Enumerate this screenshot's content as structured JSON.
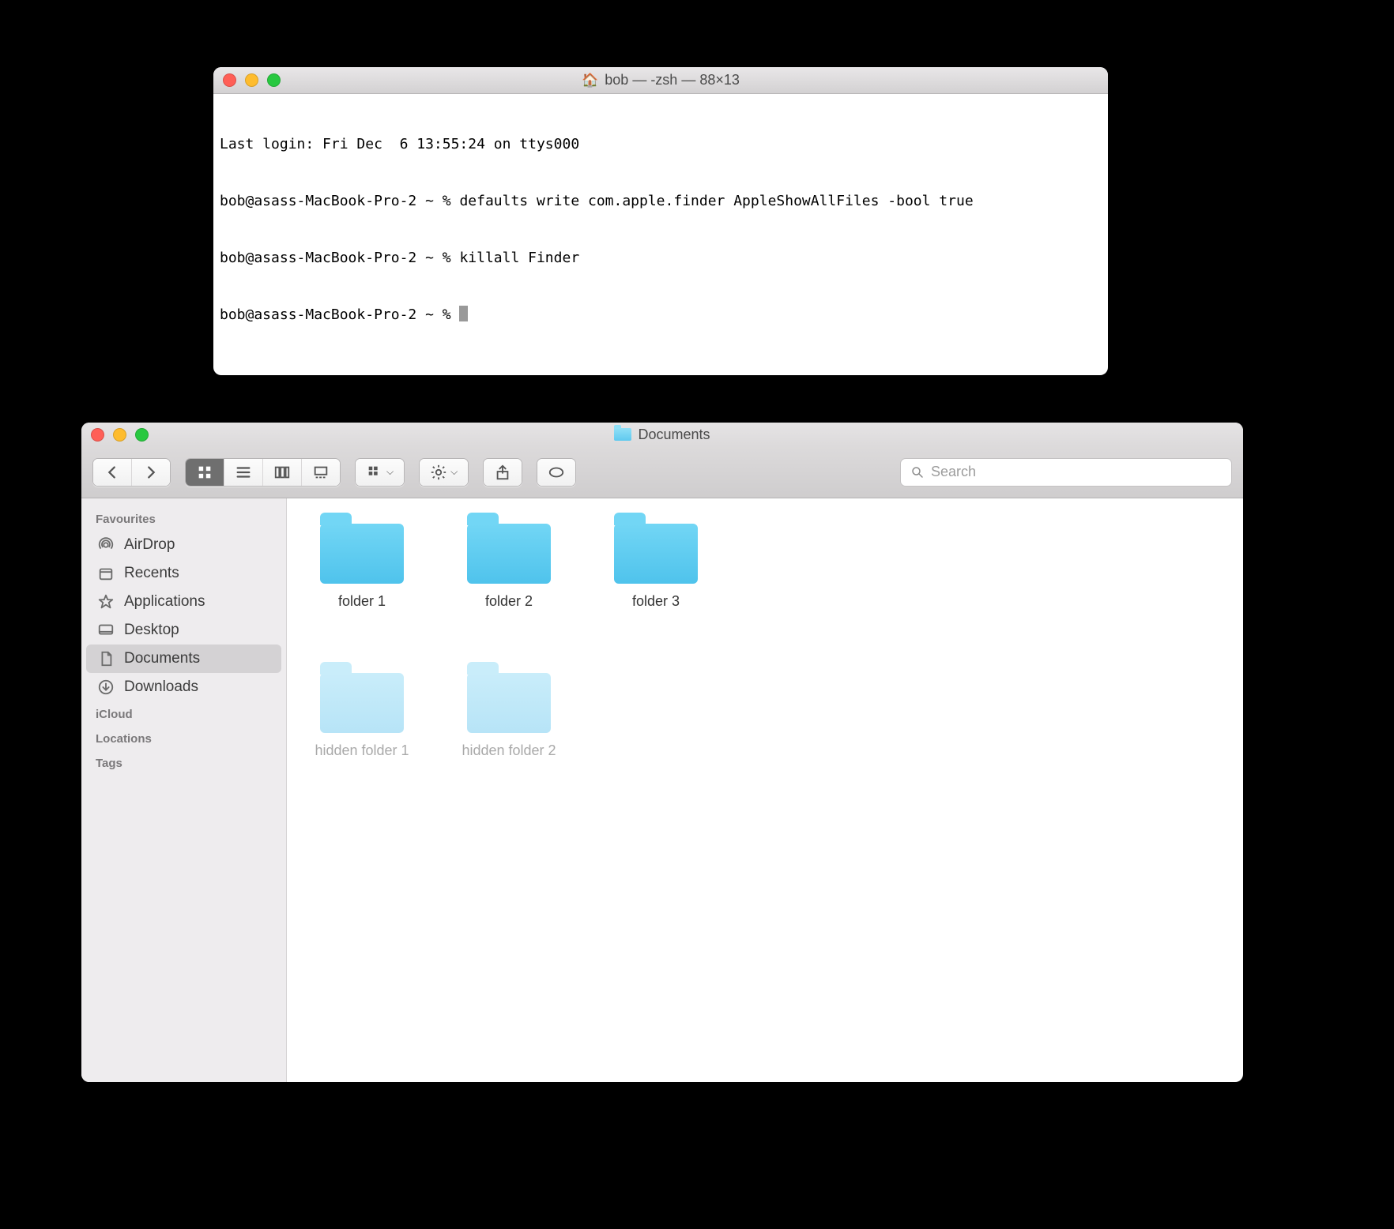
{
  "terminal": {
    "title": "bob — -zsh — 88×13",
    "lines": [
      {
        "prompt": "Last login: Fri Dec  6 13:55:24 on ttys000",
        "cmd": ""
      },
      {
        "prompt": "bob@asass-MacBook-Pro-2 ~ % ",
        "cmd": "defaults write com.apple.finder AppleShowAllFiles -bool true"
      },
      {
        "prompt": "bob@asass-MacBook-Pro-2 ~ % ",
        "cmd": "killall Finder"
      },
      {
        "prompt": "bob@asass-MacBook-Pro-2 ~ % ",
        "cmd": ""
      }
    ]
  },
  "finder": {
    "title": "Documents",
    "search_placeholder": "Search",
    "sidebar": {
      "sections": [
        {
          "header": "Favourites",
          "items": [
            {
              "label": "AirDrop",
              "icon": "airdrop-icon",
              "selected": false
            },
            {
              "label": "Recents",
              "icon": "recents-icon",
              "selected": false
            },
            {
              "label": "Applications",
              "icon": "applications-icon",
              "selected": false
            },
            {
              "label": "Desktop",
              "icon": "desktop-icon",
              "selected": false
            },
            {
              "label": "Documents",
              "icon": "documents-icon",
              "selected": true
            },
            {
              "label": "Downloads",
              "icon": "downloads-icon",
              "selected": false
            }
          ]
        },
        {
          "header": "iCloud",
          "items": []
        },
        {
          "header": "Locations",
          "items": []
        },
        {
          "header": "Tags",
          "items": []
        }
      ]
    },
    "items": [
      {
        "label": "folder 1",
        "hidden": false
      },
      {
        "label": "folder 2",
        "hidden": false
      },
      {
        "label": "folder 3",
        "hidden": false
      },
      {
        "label": "hidden folder 1",
        "hidden": true
      },
      {
        "label": "hidden folder 2",
        "hidden": true
      }
    ]
  }
}
